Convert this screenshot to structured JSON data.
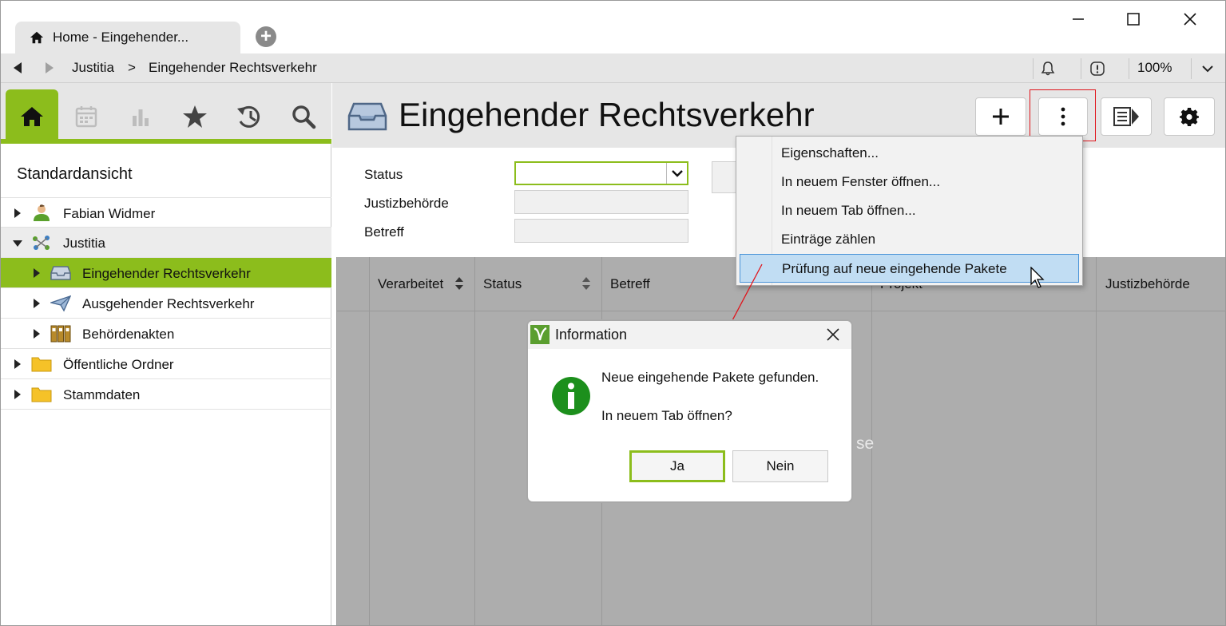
{
  "browser": {
    "tab_title": "Home - Eingehender...",
    "breadcrumb": [
      "Justitia",
      ">",
      "Eingehender Rechtsverkehr"
    ],
    "zoom": "100%"
  },
  "sidebar": {
    "view_title": "Standardansicht",
    "iconbar": [
      "home-icon",
      "calendar-icon",
      "chart-icon",
      "star-icon",
      "history-icon",
      "search-icon"
    ],
    "tree": [
      {
        "label": "Fabian Widmer",
        "icon": "person-icon",
        "expanded": false,
        "level": 0
      },
      {
        "label": "Justitia",
        "icon": "network-icon",
        "expanded": true,
        "level": 0
      },
      {
        "label": "Eingehender Rechtsverkehr",
        "icon": "inbox-icon",
        "expanded": false,
        "level": 1,
        "selected": true
      },
      {
        "label": "Ausgehender Rechtsverkehr",
        "icon": "paper-plane-icon",
        "expanded": false,
        "level": 1
      },
      {
        "label": "Behördenakten",
        "icon": "binders-icon",
        "expanded": false,
        "level": 1
      },
      {
        "label": "Öffentliche Ordner",
        "icon": "folder-icon",
        "expanded": false,
        "level": 0
      },
      {
        "label": "Stammdaten",
        "icon": "folder-icon",
        "expanded": false,
        "level": 0
      }
    ]
  },
  "main": {
    "title": "Eingehender Rechtsverkehr",
    "filters": {
      "status_label": "Status",
      "status_value": "",
      "justiz_label": "Justizbehörde",
      "justiz_value": "",
      "betreff_label": "Betreff",
      "betreff_value": ""
    },
    "columns": {
      "verarbeitet": "Verarbeitet",
      "status": "Status",
      "betreff": "Betreff",
      "projekt": "Projekt",
      "justizbehoerde": "Justizbehörde"
    },
    "partial_text": "se"
  },
  "context_menu": {
    "items": [
      "Eigenschaften...",
      "In neuem Fenster öffnen...",
      "In neuem Tab öffnen...",
      "Einträge zählen",
      "Prüfung auf neue eingehende Pakete"
    ]
  },
  "dialog": {
    "title": "Information",
    "message": "Neue eingehende Pakete gefunden.",
    "question": "In neuem Tab öffnen?",
    "yes_label": "Ja",
    "no_label": "Nein"
  },
  "colors": {
    "accent": "#8cbd1c",
    "highlight": "#c1ddf3",
    "info_green": "#1c8f1c",
    "annotation_red": "#e0141b"
  }
}
